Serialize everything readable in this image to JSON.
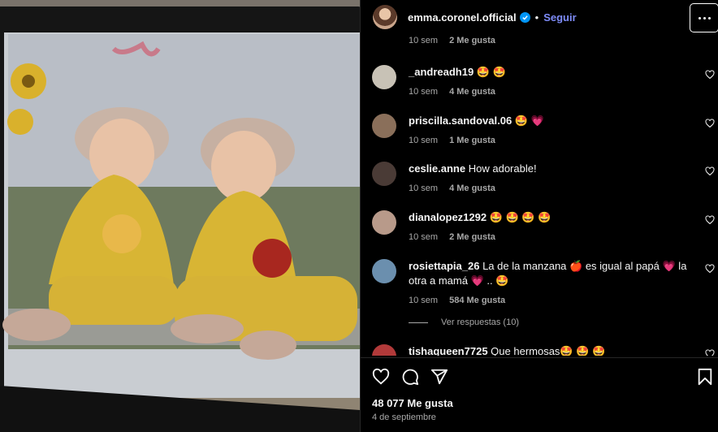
{
  "post": {
    "username": "emma.coronel.official",
    "separator": "•",
    "follow_label": "Seguir",
    "likes": "48 077 Me gusta",
    "date": "4 de septiembre"
  },
  "caption_meta": {
    "time": "10 sem",
    "likes": "2 Me gusta"
  },
  "comments": [
    {
      "user": "_andreadh19",
      "text": "🤩 🤩",
      "time": "10 sem",
      "likes": "4 Me gusta",
      "avatar_color": "#c8c2b6"
    },
    {
      "user": "priscilla.sandoval.06",
      "text": "🤩 💗",
      "time": "10 sem",
      "likes": "1 Me gusta",
      "avatar_color": "#8a6f5a"
    },
    {
      "user": "ceslie.anne",
      "text": "How adorable!",
      "time": "10 sem",
      "likes": "4 Me gusta",
      "avatar_color": "#4a3b36"
    },
    {
      "user": "dianalopez1292",
      "text": "🤩 🤩 🤩 🤩",
      "time": "10 sem",
      "likes": "2 Me gusta",
      "avatar_color": "#b89a8a"
    },
    {
      "user": "rosiettapia_26",
      "text": "La de la manzana 🍎 es igual al papá 💗 la otra a mamá 💗 .. 🤩",
      "time": "10 sem",
      "likes": "584 Me gusta",
      "avatar_color": "#6b8fae"
    },
    {
      "user": "tishaqueen7725",
      "text": "Que hermosas🤩 🤩 🤩",
      "avatar_color": "#b23a3a"
    }
  ],
  "view_replies": "Ver respuestas (10)",
  "colors": {
    "accent": "#7e8cf8",
    "verified": "#0095f6",
    "muted": "#a8a8a8",
    "background": "#000000"
  },
  "icons": [
    "verified-badge-icon",
    "more-options-icon",
    "heart-icon",
    "comment-icon",
    "share-icon",
    "bookmark-icon"
  ]
}
